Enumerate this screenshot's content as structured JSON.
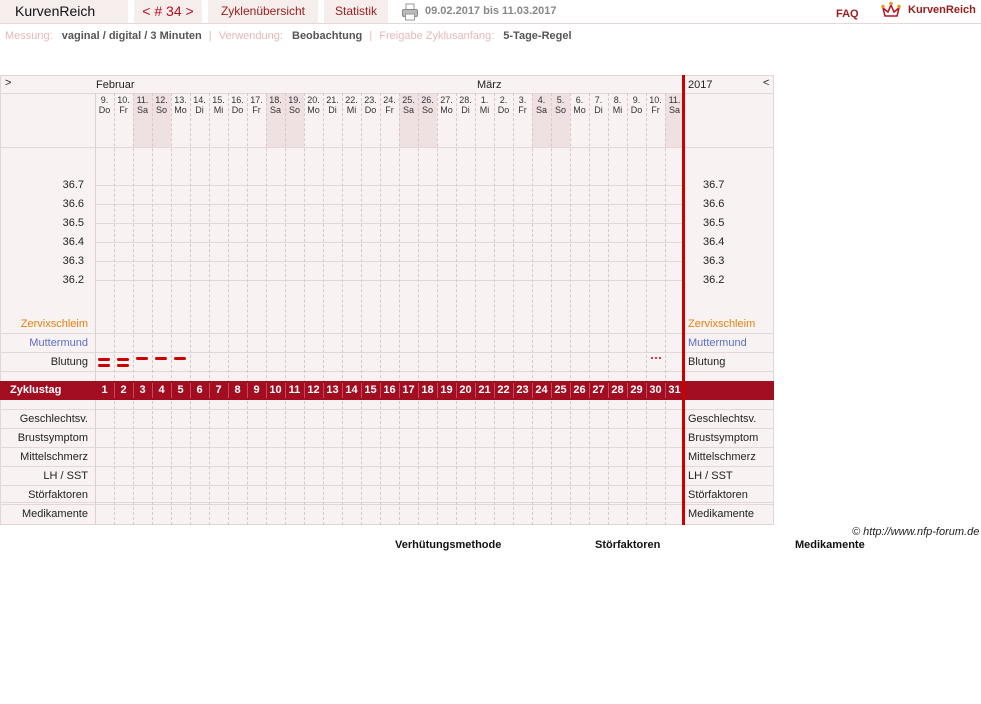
{
  "header": {
    "app_title": "KurvenReich",
    "cycle_nav": "< # 34 >",
    "tab_overview": "Zyklenübersicht",
    "tab_stats": "Statistik",
    "date_range": "09.02.2017 bis 11.03.2017",
    "faq": "FAQ",
    "logo_text": "KurvenReich"
  },
  "meta": {
    "measurement_label": "Messung:",
    "measurement_value": "vaginal / digital / 3 Minuten",
    "usage_label": "Verwendung:",
    "usage_value": "Beobachtung",
    "release_label": "Freigabe Zyklusanfang:",
    "release_value": "5-Tage-Regel"
  },
  "chart": {
    "nav_left": ">",
    "nav_right": "<",
    "month_feb": "Februar",
    "month_mar": "März",
    "year": "2017",
    "days": [
      {
        "n": "9.",
        "w": "Do",
        "we": false
      },
      {
        "n": "10.",
        "w": "Fr",
        "we": false
      },
      {
        "n": "11.",
        "w": "Sa",
        "we": true
      },
      {
        "n": "12.",
        "w": "So",
        "we": true
      },
      {
        "n": "13.",
        "w": "Mo",
        "we": false
      },
      {
        "n": "14.",
        "w": "Di",
        "we": false
      },
      {
        "n": "15.",
        "w": "Mi",
        "we": false
      },
      {
        "n": "16.",
        "w": "Do",
        "we": false
      },
      {
        "n": "17.",
        "w": "Fr",
        "we": false
      },
      {
        "n": "18.",
        "w": "Sa",
        "we": true
      },
      {
        "n": "19.",
        "w": "So",
        "we": true
      },
      {
        "n": "20.",
        "w": "Mo",
        "we": false
      },
      {
        "n": "21.",
        "w": "Di",
        "we": false
      },
      {
        "n": "22.",
        "w": "Mi",
        "we": false
      },
      {
        "n": "23.",
        "w": "Do",
        "we": false
      },
      {
        "n": "24.",
        "w": "Fr",
        "we": false
      },
      {
        "n": "25.",
        "w": "Sa",
        "we": true
      },
      {
        "n": "26.",
        "w": "So",
        "we": true
      },
      {
        "n": "27.",
        "w": "Mo",
        "we": false
      },
      {
        "n": "28.",
        "w": "Di",
        "we": false
      },
      {
        "n": "1.",
        "w": "Mi",
        "we": false
      },
      {
        "n": "2.",
        "w": "Do",
        "we": false
      },
      {
        "n": "3.",
        "w": "Fr",
        "we": false
      },
      {
        "n": "4.",
        "w": "Sa",
        "we": true
      },
      {
        "n": "5.",
        "w": "So",
        "we": true
      },
      {
        "n": "6.",
        "w": "Mo",
        "we": false
      },
      {
        "n": "7.",
        "w": "Di",
        "we": false
      },
      {
        "n": "8.",
        "w": "Mi",
        "we": false
      },
      {
        "n": "9.",
        "w": "Do",
        "we": false
      },
      {
        "n": "10.",
        "w": "Fr",
        "we": false
      },
      {
        "n": "11.",
        "w": "Sa",
        "we": true
      }
    ],
    "temps": [
      "36.7",
      "36.6",
      "36.5",
      "36.4",
      "36.3",
      "36.2"
    ],
    "rows": {
      "cervix": "Zervixschleim",
      "cervix_color": "#e8820c",
      "os": "Muttermund",
      "os_color": "#5a6fc8",
      "bleeding": "Blutung",
      "cycle_day": "Zyklustag",
      "intercourse": "Geschlechtsv.",
      "breast": "Brustsymptom",
      "midpain": "Mittelschmerz",
      "lh": "LH / SST",
      "disturb": "Störfaktoren",
      "meds": "Medikamente"
    },
    "bleeding": [
      {
        "day": 1,
        "level": "heavy"
      },
      {
        "day": 2,
        "level": "heavy"
      },
      {
        "day": 3,
        "level": "medium"
      },
      {
        "day": 4,
        "level": "medium"
      },
      {
        "day": 5,
        "level": "medium"
      },
      {
        "day": 30,
        "level": "spotting"
      }
    ],
    "cycle_days": [
      "1",
      "2",
      "3",
      "4",
      "5",
      "6",
      "7",
      "8",
      "9",
      "10",
      "11",
      "12",
      "13",
      "14",
      "15",
      "16",
      "17",
      "18",
      "19",
      "20",
      "21",
      "22",
      "23",
      "24",
      "25",
      "26",
      "27",
      "28",
      "29",
      "30",
      "31"
    ],
    "accent_color": "#a30d22"
  },
  "footer": {
    "copyright": "© http://www.nfp-forum.de",
    "legend_contra": "Verhütungsmethode",
    "legend_disturb": "Störfaktoren",
    "legend_meds": "Medikamente"
  }
}
